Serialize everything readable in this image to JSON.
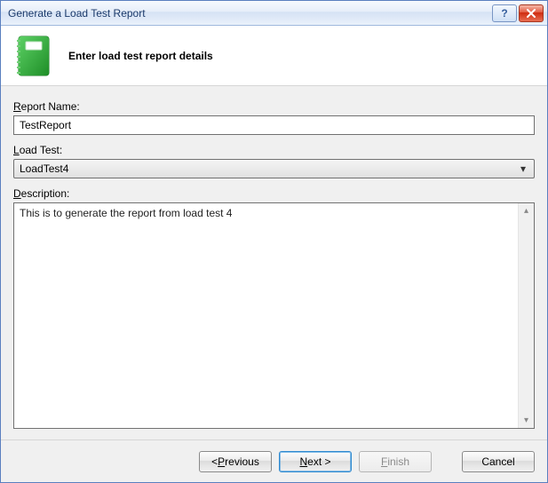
{
  "window": {
    "title": "Generate a Load Test Report"
  },
  "header": {
    "heading": "Enter load test report details"
  },
  "form": {
    "reportName": {
      "labelPrefix": "R",
      "labelRest": "eport Name:",
      "value": "TestReport"
    },
    "loadTest": {
      "labelPrefix": "L",
      "labelRest": "oad Test:",
      "selected": "LoadTest4"
    },
    "description": {
      "labelPrefix": "D",
      "labelRest": "escription:",
      "value": "This is to generate the report from load test 4"
    }
  },
  "footer": {
    "previous": {
      "lt": "< ",
      "u": "P",
      "rest": "revious"
    },
    "next": {
      "u": "N",
      "rest": "ext >"
    },
    "finish": {
      "u": "F",
      "rest": "inish"
    },
    "cancel": {
      "label": "Cancel"
    }
  }
}
